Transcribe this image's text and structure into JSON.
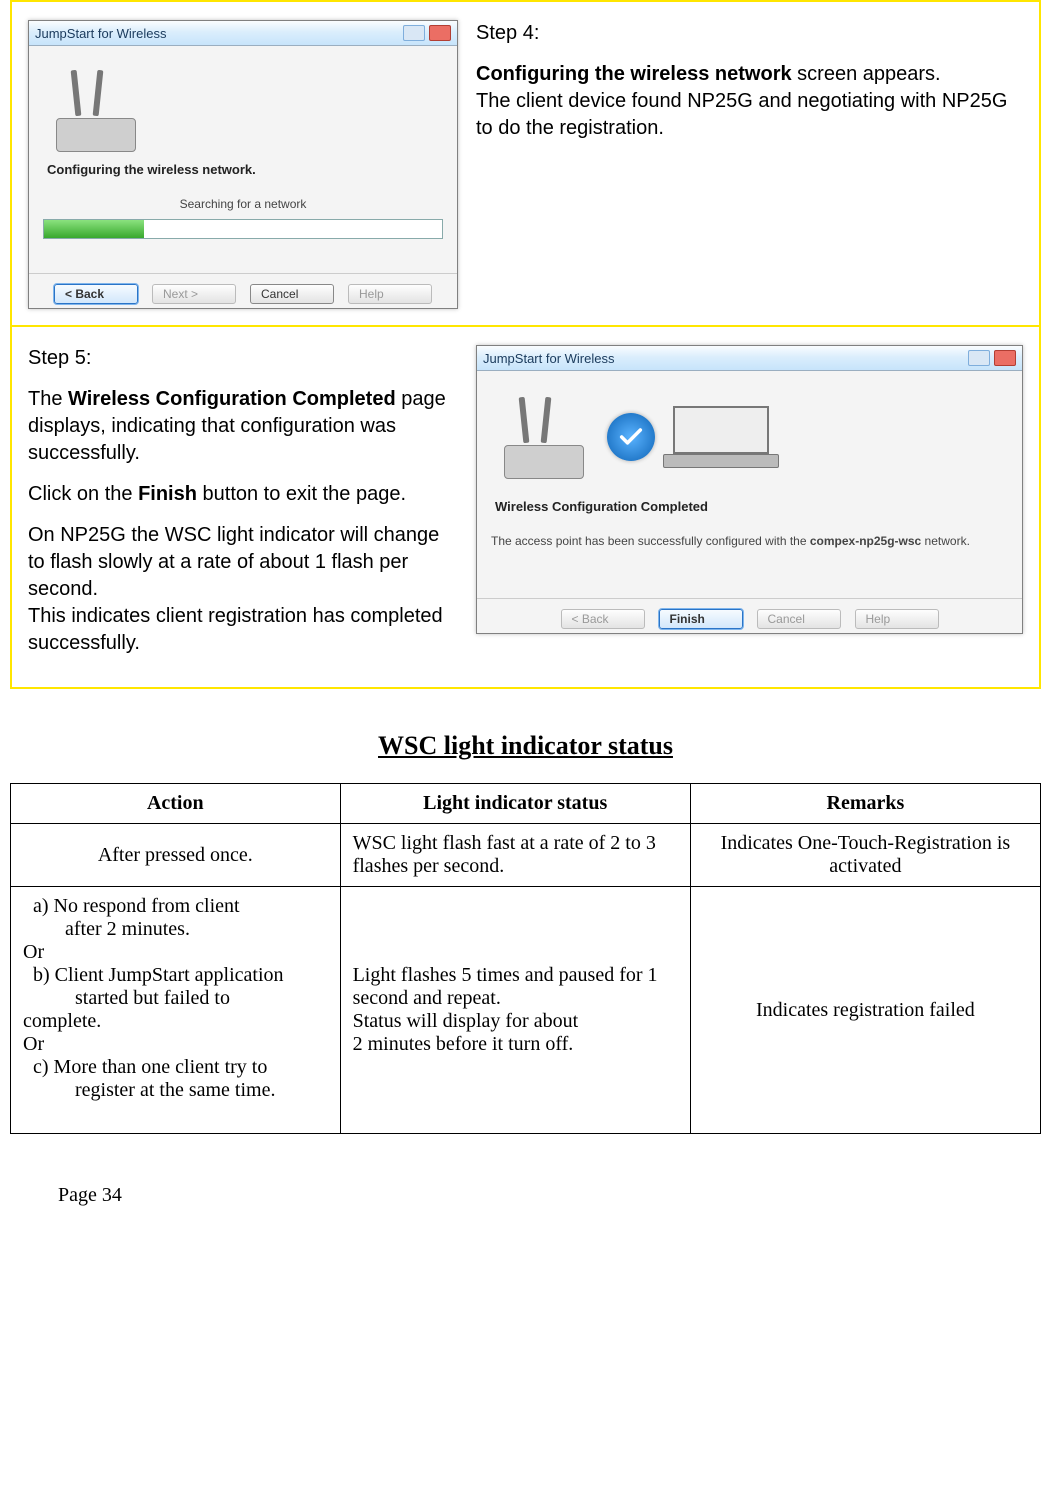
{
  "window_title": "JumpStart for Wireless",
  "step4": {
    "label": "Step 4:",
    "screen_name": "Configuring the wireless network",
    "after_screen_name": " screen appears.",
    "desc": "The client device found NP25G and negotiating with NP25G to do the registration.",
    "cfg_header": "Configuring the wireless network.",
    "search_caption": "Searching for a network",
    "buttons": {
      "back": "< Back",
      "next": "Next >",
      "cancel": "Cancel",
      "help": "Help"
    }
  },
  "step5": {
    "label": "Step 5:",
    "p1_pre": "The ",
    "p1_bold": "Wireless Configuration Completed",
    "p1_post": " page displays, indicating that configuration was successfully.",
    "p2_pre": "Click on the ",
    "p2_bold": "Finish",
    "p2_post": " button to exit the page.",
    "p3": "On NP25G the WSC light indicator will change to flash slowly at a rate of about 1 flash per second.",
    "p4": "This indicates client registration has completed   successfully.",
    "cfg_header": "Wireless Configuration Completed",
    "cfg_desc_pre": "The access point has been successfully configured with the ",
    "cfg_desc_bold": "compex-np25g-wsc",
    "cfg_desc_post": " network.",
    "buttons": {
      "back": "< Back",
      "finish": "Finish",
      "cancel": "Cancel",
      "help": "Help"
    }
  },
  "table": {
    "title": "WSC light indicator status",
    "headers": {
      "action": "Action",
      "status": "Light indicator status",
      "remarks": "Remarks"
    },
    "rows": [
      {
        "action_html": "After pressed once.",
        "status": "WSC light flash fast at a rate of 2 to 3 flashes per second.",
        "remarks": "Indicates One-Touch-Registration is activated"
      },
      {
        "action_a_prefix": "a) No respond from     client",
        "action_a_line2": "after 2 minutes.",
        "or1": "Or",
        "action_b_prefix": "b) Client JumpStart application",
        "action_b_line2": "started but failed to",
        "action_b_line3": "complete.",
        "or2": "Or",
        "action_c_prefix": "c) More than one client try to",
        "action_c_line2": "register at the same time.",
        "status_l1": "Light flashes 5 times and paused for 1 second and repeat.",
        "status_l2": "Status will display for about",
        "status_l3": "2 minutes before it turn off.",
        "remarks": "Indicates registration failed"
      }
    ]
  },
  "page_number": "Page 34"
}
